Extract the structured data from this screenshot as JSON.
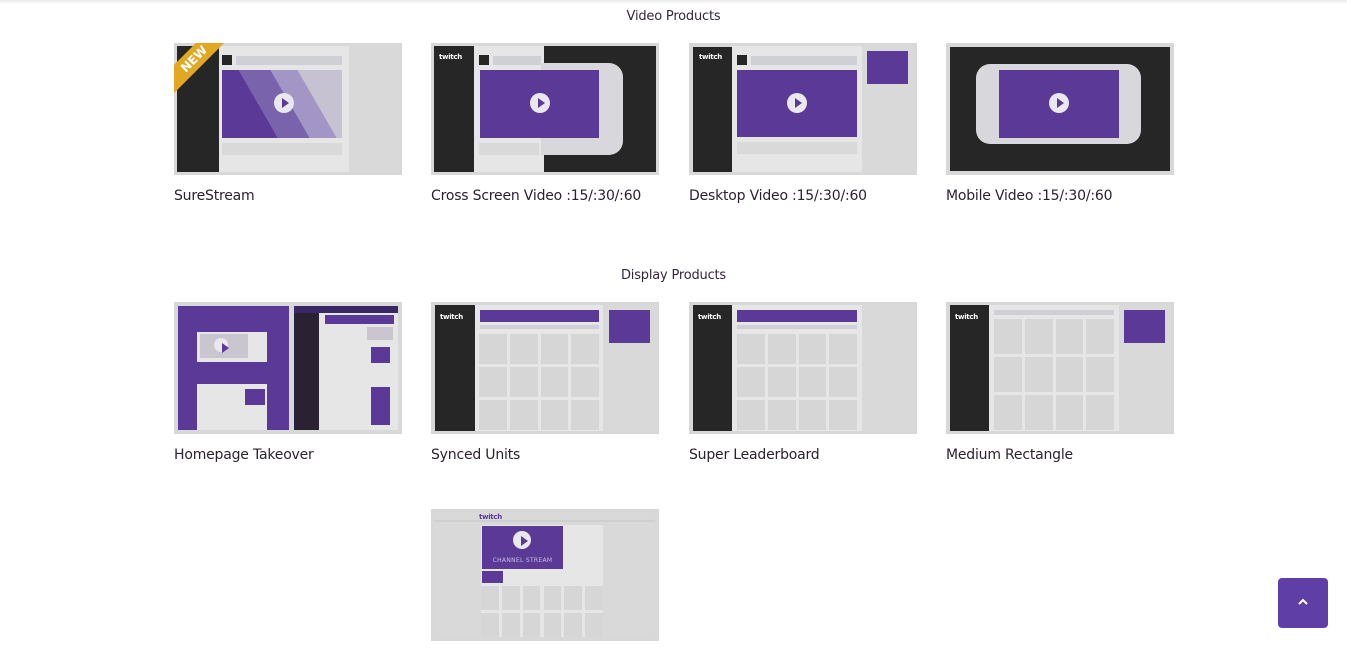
{
  "sections": [
    {
      "title": "Video Products",
      "items": [
        {
          "label": "SureStream",
          "badge": "NEW"
        },
        {
          "label": "Cross Screen Video :15/:30/:60"
        },
        {
          "label": "Desktop Video :15/:30/:60"
        },
        {
          "label": "Mobile Video :15/:30/:60"
        }
      ]
    },
    {
      "title": "Display Products",
      "items": [
        {
          "label": "Homepage Takeover"
        },
        {
          "label": "Synced Units"
        },
        {
          "label": "Super Leaderboard"
        },
        {
          "label": "Medium Rectangle"
        },
        {
          "label": "",
          "inner_text": "CHANNEL STREAM"
        }
      ]
    }
  ],
  "logo_text": "twitch",
  "scroll_top_icon": "chevron-up-icon",
  "colors": {
    "accent": "#5b3a97",
    "badge": "#e0a823",
    "dark": "#262626",
    "button": "#5f3ea6"
  }
}
